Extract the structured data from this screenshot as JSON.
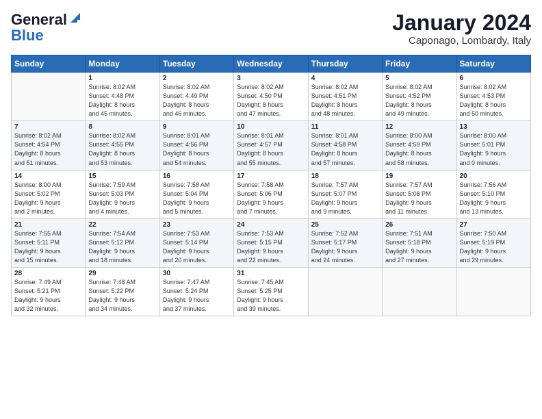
{
  "header": {
    "logo_line1": "General",
    "logo_line2": "Blue",
    "title": "January 2024",
    "subtitle": "Caponago, Lombardy, Italy"
  },
  "calendar": {
    "days_of_week": [
      "Sunday",
      "Monday",
      "Tuesday",
      "Wednesday",
      "Thursday",
      "Friday",
      "Saturday"
    ],
    "weeks": [
      [
        {
          "day": "",
          "info": ""
        },
        {
          "day": "1",
          "info": "Sunrise: 8:02 AM\nSunset: 4:48 PM\nDaylight: 8 hours\nand 45 minutes."
        },
        {
          "day": "2",
          "info": "Sunrise: 8:02 AM\nSunset: 4:49 PM\nDaylight: 8 hours\nand 46 minutes."
        },
        {
          "day": "3",
          "info": "Sunrise: 8:02 AM\nSunset: 4:50 PM\nDaylight: 8 hours\nand 47 minutes."
        },
        {
          "day": "4",
          "info": "Sunrise: 8:02 AM\nSunset: 4:51 PM\nDaylight: 8 hours\nand 48 minutes."
        },
        {
          "day": "5",
          "info": "Sunrise: 8:02 AM\nSunset: 4:52 PM\nDaylight: 8 hours\nand 49 minutes."
        },
        {
          "day": "6",
          "info": "Sunrise: 8:02 AM\nSunset: 4:53 PM\nDaylight: 8 hours\nand 50 minutes."
        }
      ],
      [
        {
          "day": "7",
          "info": "Sunrise: 8:02 AM\nSunset: 4:54 PM\nDaylight: 8 hours\nand 51 minutes."
        },
        {
          "day": "8",
          "info": "Sunrise: 8:02 AM\nSunset: 4:55 PM\nDaylight: 8 hours\nand 53 minutes."
        },
        {
          "day": "9",
          "info": "Sunrise: 8:01 AM\nSunset: 4:56 PM\nDaylight: 8 hours\nand 54 minutes."
        },
        {
          "day": "10",
          "info": "Sunrise: 8:01 AM\nSunset: 4:57 PM\nDaylight: 8 hours\nand 55 minutes."
        },
        {
          "day": "11",
          "info": "Sunrise: 8:01 AM\nSunset: 4:58 PM\nDaylight: 8 hours\nand 57 minutes."
        },
        {
          "day": "12",
          "info": "Sunrise: 8:00 AM\nSunset: 4:59 PM\nDaylight: 8 hours\nand 58 minutes."
        },
        {
          "day": "13",
          "info": "Sunrise: 8:00 AM\nSunset: 5:01 PM\nDaylight: 9 hours\nand 0 minutes."
        }
      ],
      [
        {
          "day": "14",
          "info": "Sunrise: 8:00 AM\nSunset: 5:02 PM\nDaylight: 9 hours\nand 2 minutes."
        },
        {
          "day": "15",
          "info": "Sunrise: 7:59 AM\nSunset: 5:03 PM\nDaylight: 9 hours\nand 4 minutes."
        },
        {
          "day": "16",
          "info": "Sunrise: 7:58 AM\nSunset: 5:04 PM\nDaylight: 9 hours\nand 5 minutes."
        },
        {
          "day": "17",
          "info": "Sunrise: 7:58 AM\nSunset: 5:06 PM\nDaylight: 9 hours\nand 7 minutes."
        },
        {
          "day": "18",
          "info": "Sunrise: 7:57 AM\nSunset: 5:07 PM\nDaylight: 9 hours\nand 9 minutes."
        },
        {
          "day": "19",
          "info": "Sunrise: 7:57 AM\nSunset: 5:08 PM\nDaylight: 9 hours\nand 11 minutes."
        },
        {
          "day": "20",
          "info": "Sunrise: 7:56 AM\nSunset: 5:10 PM\nDaylight: 9 hours\nand 13 minutes."
        }
      ],
      [
        {
          "day": "21",
          "info": "Sunrise: 7:55 AM\nSunset: 5:11 PM\nDaylight: 9 hours\nand 15 minutes."
        },
        {
          "day": "22",
          "info": "Sunrise: 7:54 AM\nSunset: 5:12 PM\nDaylight: 9 hours\nand 18 minutes."
        },
        {
          "day": "23",
          "info": "Sunrise: 7:53 AM\nSunset: 5:14 PM\nDaylight: 9 hours\nand 20 minutes."
        },
        {
          "day": "24",
          "info": "Sunrise: 7:53 AM\nSunset: 5:15 PM\nDaylight: 9 hours\nand 22 minutes."
        },
        {
          "day": "25",
          "info": "Sunrise: 7:52 AM\nSunset: 5:17 PM\nDaylight: 9 hours\nand 24 minutes."
        },
        {
          "day": "26",
          "info": "Sunrise: 7:51 AM\nSunset: 5:18 PM\nDaylight: 9 hours\nand 27 minutes."
        },
        {
          "day": "27",
          "info": "Sunrise: 7:50 AM\nSunset: 5:19 PM\nDaylight: 9 hours\nand 29 minutes."
        }
      ],
      [
        {
          "day": "28",
          "info": "Sunrise: 7:49 AM\nSunset: 5:21 PM\nDaylight: 9 hours\nand 32 minutes."
        },
        {
          "day": "29",
          "info": "Sunrise: 7:48 AM\nSunset: 5:22 PM\nDaylight: 9 hours\nand 34 minutes."
        },
        {
          "day": "30",
          "info": "Sunrise: 7:47 AM\nSunset: 5:24 PM\nDaylight: 9 hours\nand 37 minutes."
        },
        {
          "day": "31",
          "info": "Sunrise: 7:45 AM\nSunset: 5:25 PM\nDaylight: 9 hours\nand 39 minutes."
        },
        {
          "day": "",
          "info": ""
        },
        {
          "day": "",
          "info": ""
        },
        {
          "day": "",
          "info": ""
        }
      ]
    ]
  }
}
